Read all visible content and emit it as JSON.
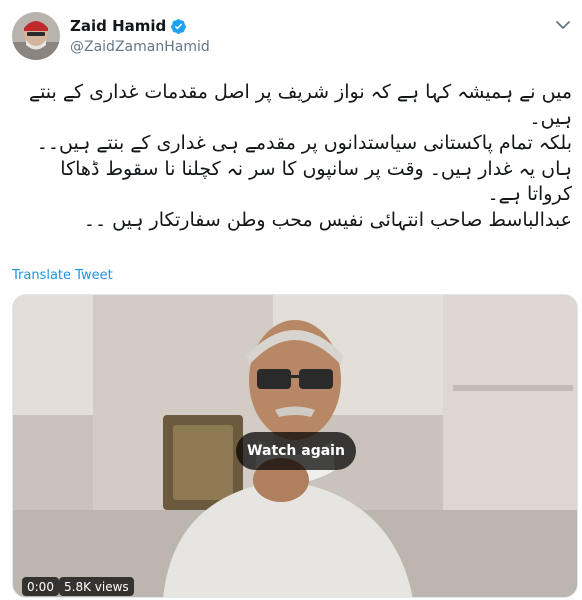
{
  "user": {
    "display_name": "Zaid Hamid",
    "handle": "@ZaidZamanHamid",
    "verified": true
  },
  "tweet": {
    "lines": [
      "میں نے ہمیشہ کہا ہے کہ نواز شریف پر اصل مقدمات غداری کے بنتے ہیں۔",
      "بلکہ تمام پاکستانی سیاستدانوں پر مقدمے ہی غداری کے بنتے ہیں۔۔",
      "ہاں یہ غدار ہیں۔ وقت پر سانپوں کا سر نہ کچلنا نا سقوط ڈھاکا کرواتا ہے۔",
      "عبدالباسط صاحب انتہائی نفیس محب وطن سفارتکار ہیں ۔۔"
    ],
    "translate_label": "Translate Tweet"
  },
  "video": {
    "watch_again_label": "Watch again",
    "timestamp": "0:00",
    "views": "5.8K views"
  },
  "colors": {
    "link": "#1b95e0",
    "verified": "#1da1f2",
    "secondary_text": "#657786"
  },
  "icons": {
    "verified": "verified-badge-icon",
    "menu": "chevron-down-icon"
  }
}
